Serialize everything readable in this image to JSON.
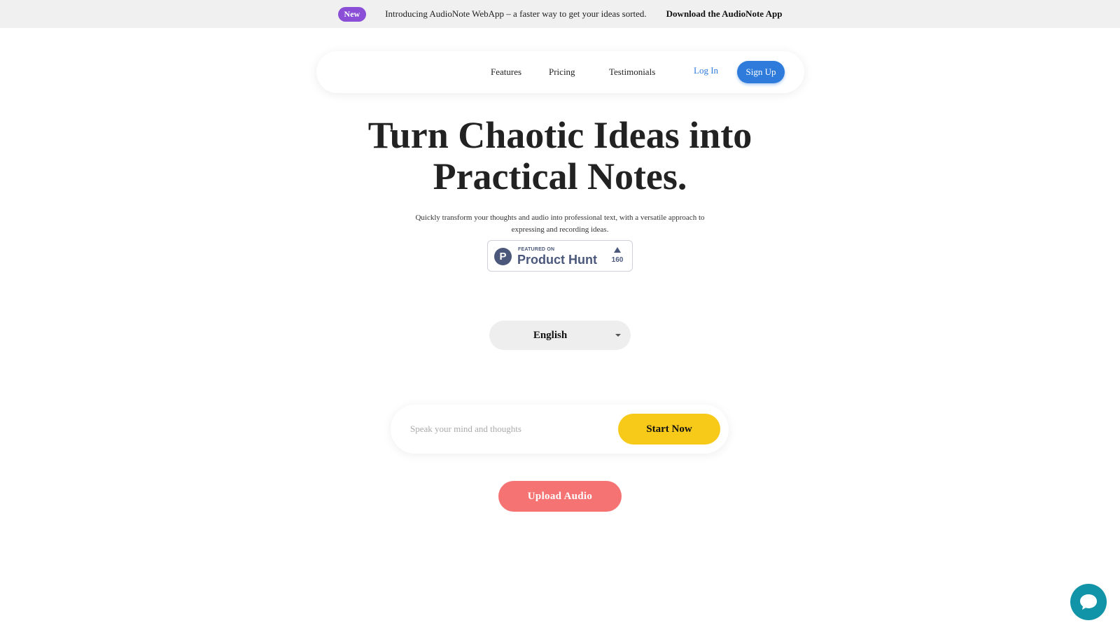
{
  "announcement": {
    "badge": "New",
    "text": "Introducing AudioNote WebApp – a faster way to get your ideas sorted.",
    "link": "Download the AudioNote App"
  },
  "nav": {
    "links": [
      "Features",
      "Pricing",
      "Testimonials"
    ],
    "login": "Log In",
    "signup": "Sign Up"
  },
  "hero": {
    "title_line1": "Turn Chaotic Ideas into",
    "title_line2": "Practical Notes.",
    "subtitle": "Quickly transform your thoughts and audio into professional text, with a versatile approach to expressing and recording ideas."
  },
  "product_hunt": {
    "logo_letter": "P",
    "featured": "FEATURED ON",
    "name": "Product Hunt",
    "count": "160"
  },
  "language": {
    "selected": "English"
  },
  "input": {
    "placeholder": "Speak your mind and thoughts",
    "start_label": "Start Now"
  },
  "upload": {
    "label": "Upload Audio"
  },
  "colors": {
    "accent_blue": "#2f7bdc",
    "badge_purple": "#8a4fd6",
    "start_yellow": "#f7c919",
    "upload_coral": "#f67373",
    "chat_teal": "#1193a8"
  },
  "icons": {
    "chat": "chat-bubble-icon",
    "dropdown": "chevron-down-icon",
    "upvote": "upvote-triangle-icon"
  }
}
